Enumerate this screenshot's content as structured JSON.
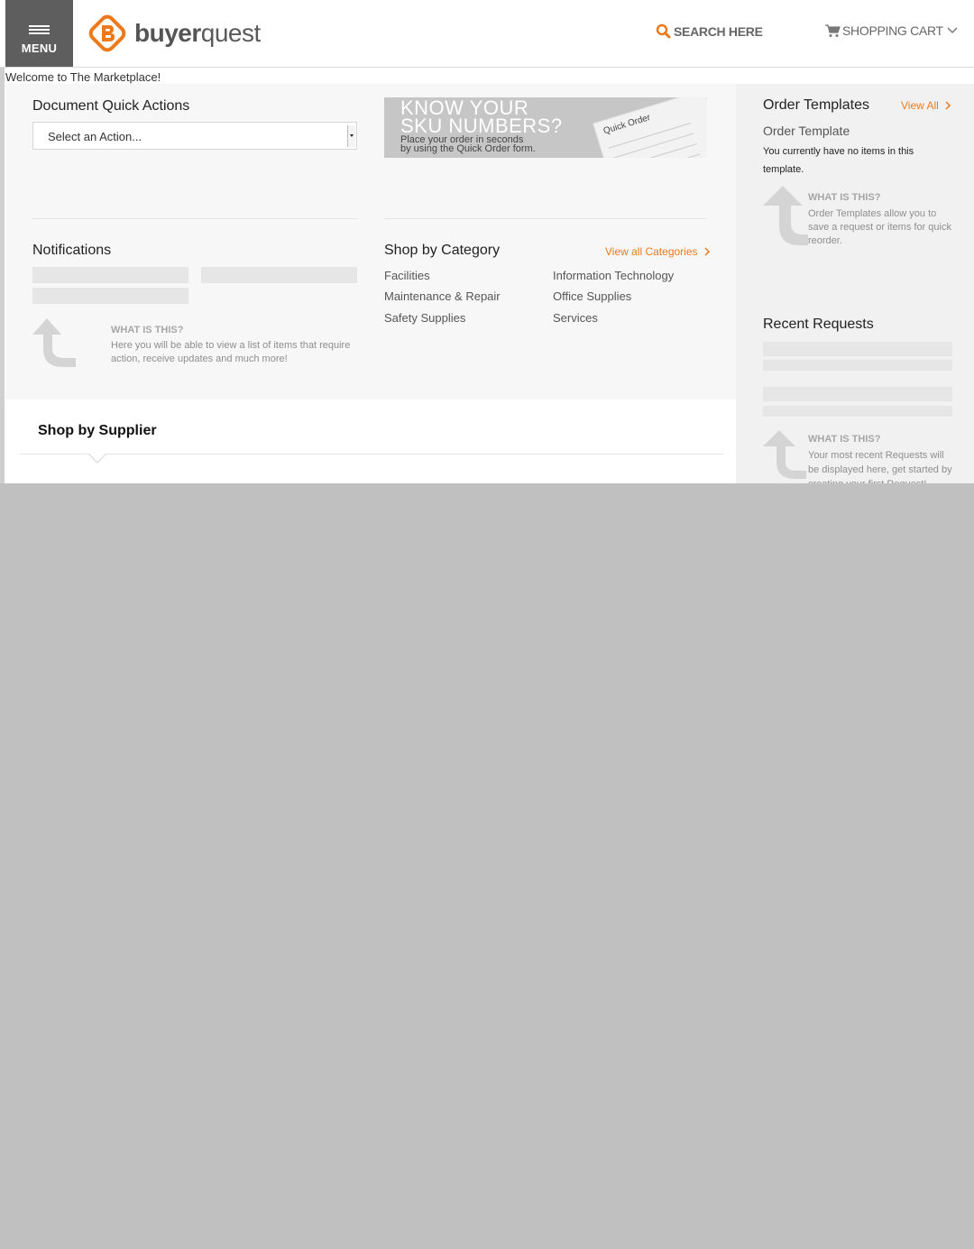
{
  "header": {
    "menu_label": "MENU",
    "logo_text_bold": "buyer",
    "logo_text_light": "quest",
    "search_label": "SEARCH HERE",
    "cart_label": "SHOPPING CART"
  },
  "welcome_text": "Welcome to The Marketplace!",
  "quick_actions": {
    "title": "Document Quick Actions",
    "select_value": "Select an Action..."
  },
  "banner": {
    "line1": "KNOW YOUR",
    "line2": "SKU NUMBERS?",
    "sub1": "Place your order in seconds",
    "sub2": "by using the Quick Order form.",
    "paper_title": "Quick Order"
  },
  "notifications": {
    "title": "Notifications",
    "what_title": "WHAT IS THIS?",
    "what_text": "Here you will be able to view a list of items that require action, receive updates and much more!"
  },
  "categories": {
    "title": "Shop by Category",
    "view_all": "View all Categories",
    "items": [
      "Facilities",
      "Information Technology",
      "Maintenance & Repair",
      "Office Supplies",
      "Safety Supplies",
      "Services"
    ]
  },
  "order_templates": {
    "title": "Order Templates",
    "view_all": "View All",
    "subtitle": "Order Template",
    "empty_text": "You currently have no items in this template.",
    "what_title": "WHAT IS THIS?",
    "what_text": "Order Templates allow you to save a request or items for quick reorder."
  },
  "recent_requests": {
    "title": "Recent Requests",
    "what_title": "WHAT IS THIS?",
    "what_text": "Your most recent Requests will be displayed here, get started by creating your first Request!"
  },
  "supplier": {
    "title": "Shop by Supplier"
  },
  "colors": {
    "accent": "#ec7a1c",
    "menu_bg": "#5e5e5e"
  }
}
